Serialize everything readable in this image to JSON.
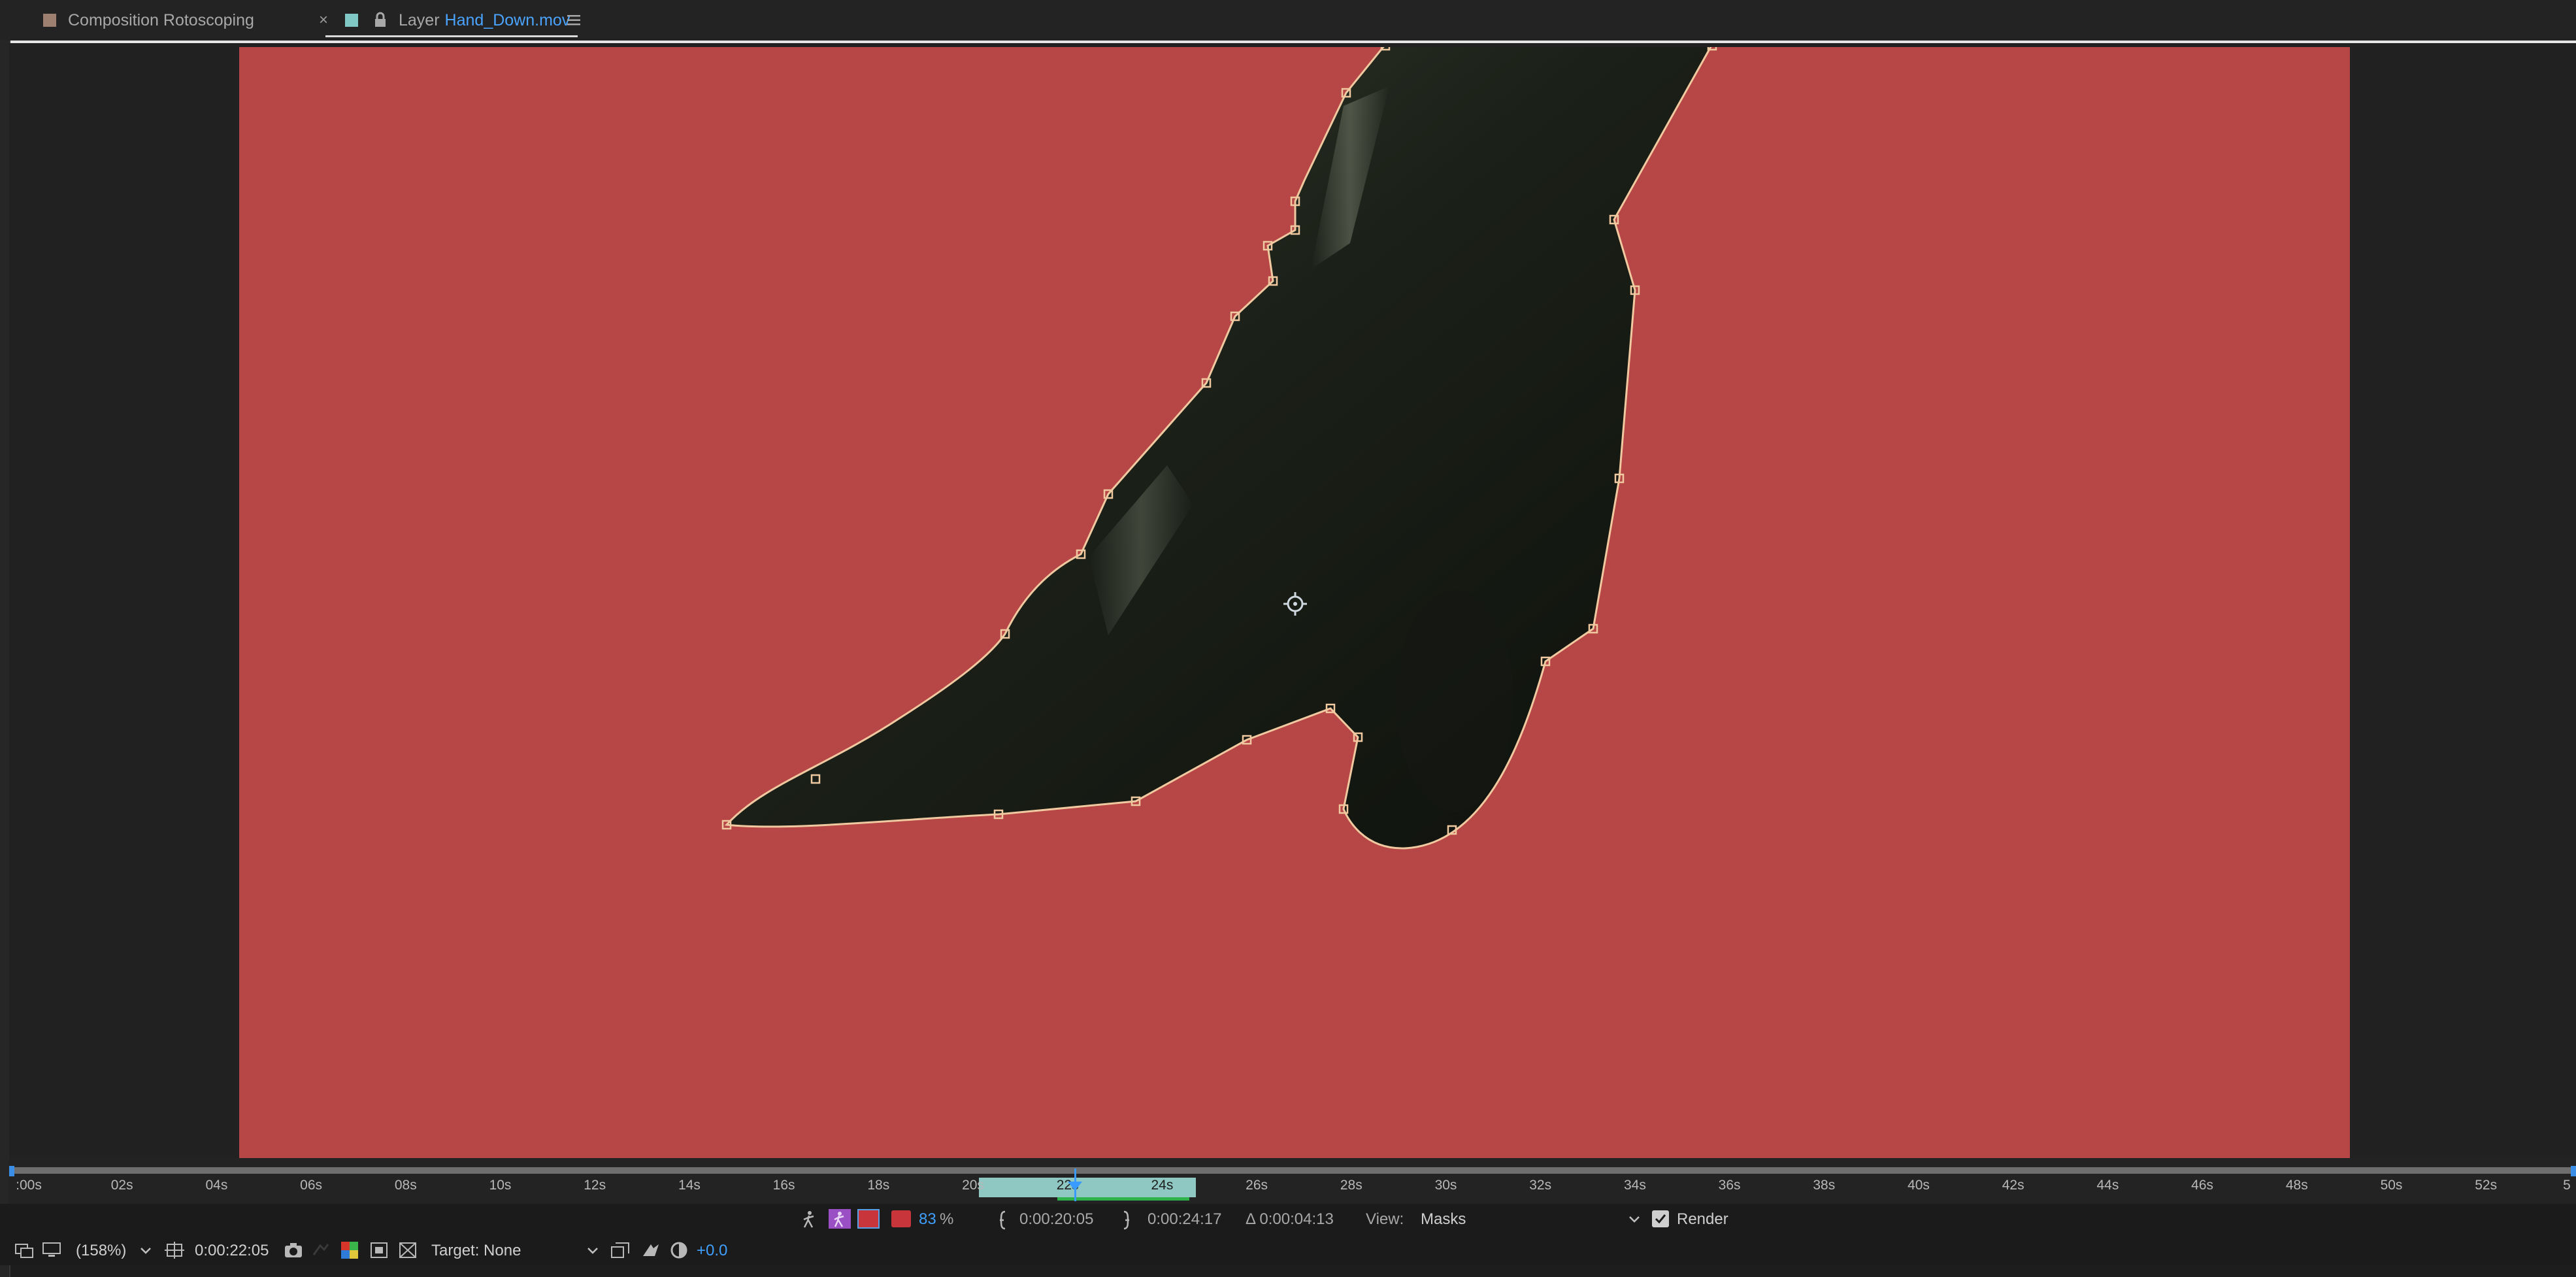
{
  "tabs": {
    "composition": {
      "label": "Composition Rotoscoping",
      "close": "×"
    },
    "layer": {
      "prefix": "Layer",
      "name": "Hand_Down.mov"
    }
  },
  "viewer": {
    "background_color": "#b74646",
    "mask_color": "#f0c9a0"
  },
  "timeline": {
    "ticks": [
      ":00s",
      "02s",
      "04s",
      "06s",
      "08s",
      "10s",
      "12s",
      "14s",
      "16s",
      "18s",
      "20s",
      "22s",
      "24s",
      "26s",
      "28s",
      "30s",
      "32s",
      "34s",
      "36s",
      "38s",
      "40s",
      "42s",
      "44s",
      "46s",
      "48s",
      "50s",
      "52s",
      "5"
    ]
  },
  "layer_controls": {
    "opacity_value": "83",
    "opacity_unit": "%",
    "in_point": "0:00:20:05",
    "out_point": "0:00:24:17",
    "duration": "Δ 0:00:04:13",
    "view_label": "View:",
    "view_value": "Masks",
    "render_label": "Render",
    "render_checked": true
  },
  "viewer_controls": {
    "zoom": "(158%)",
    "current_time": "0:00:22:05",
    "target": "Target: None",
    "exposure": "+0.0"
  }
}
